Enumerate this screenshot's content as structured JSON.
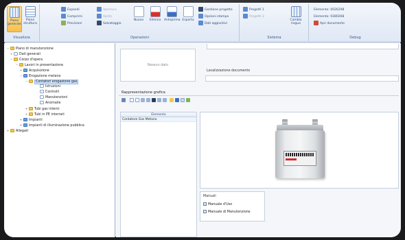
{
  "ribbon": {
    "groups": {
      "visualizza": "Visualizza",
      "operazioni": "Operazioni",
      "sistema": "Sistema",
      "debug": "Debug"
    },
    "view_buttons": [
      "Piano generale",
      "Piano struttura"
    ],
    "small_col1": [
      "Espandi",
      "Comprimi",
      "Previsioni"
    ],
    "small_col2": [
      "Apertura",
      "Aprile",
      "Salvataggio"
    ],
    "big_buttons": [
      "Nuovo",
      "Elimina",
      "Anteprima",
      "Esporta"
    ],
    "small_col3": [
      "Gestione progetto",
      "Opzioni stampa",
      "Dati aggiuntivi"
    ],
    "small_col4": [
      "Progetti 1",
      "Progetti 2"
    ],
    "sistema_button": "Cambia lingua",
    "debug_items": [
      "Elemento: 0026298",
      "Elemento: 0280268",
      "Apri documento"
    ]
  },
  "tree": {
    "nodes": [
      {
        "label": "Piano di manutenzione",
        "exp": "−",
        "icon": "folder"
      },
      {
        "label": "Dati generali",
        "exp": "+",
        "icon": "doc"
      },
      {
        "label": "Corpo d'opera",
        "exp": "−",
        "icon": "folder"
      },
      {
        "label": "Lavori in presentazione",
        "exp": "−",
        "icon": "folder"
      },
      {
        "label": "Acquisizione",
        "exp": "+",
        "icon": "item"
      },
      {
        "label": "Erogazione metano",
        "exp": "−",
        "icon": "item"
      },
      {
        "label": "Contatori erogazione gas",
        "exp": "−",
        "icon": "folder"
      },
      {
        "label": "Istruzioni",
        "exp": "",
        "icon": "doc"
      },
      {
        "label": "Controlli",
        "exp": "",
        "icon": "doc"
      },
      {
        "label": "Manutenzioni",
        "exp": "",
        "icon": "doc"
      },
      {
        "label": "Anomalie",
        "exp": "",
        "icon": "doc"
      },
      {
        "label": "Tubi gas interni",
        "exp": "+",
        "icon": "folder"
      },
      {
        "label": "Tubi in PE interrati",
        "exp": "+",
        "icon": "folder"
      },
      {
        "label": "Impianti",
        "exp": "+",
        "icon": "item"
      },
      {
        "label": "Impianti di illuminazione pubblica",
        "exp": "+",
        "icon": "item"
      },
      {
        "label": "Allegati",
        "exp": "+",
        "icon": "folder"
      }
    ]
  },
  "main": {
    "image_placeholder": "Nessun dato",
    "field_label": "Localizzazione documento",
    "section_title": "Rappresentazione grafica",
    "grid_header": "Elemento",
    "grid_row": "Contatore Gas Metano",
    "checks_title": "Manuali",
    "checks": [
      "Manuale d'Uso",
      "Manuale di Manutenzione"
    ]
  }
}
